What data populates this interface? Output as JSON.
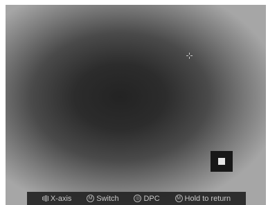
{
  "hints": [
    {
      "icon": "scroll-wheel-icon",
      "label": "X-axis"
    },
    {
      "icon": "m-button-icon",
      "label": "Switch",
      "glyph": "M"
    },
    {
      "icon": "camera-button-icon",
      "label": "DPC",
      "glyph": "◎"
    },
    {
      "icon": "m-button-icon",
      "label": "Hold to return",
      "glyph": "M"
    }
  ],
  "colors": {
    "image_center": "#232323",
    "image_edge": "#a6a6a6",
    "hint_text": "#c9c9c9",
    "hint_bar_bg": "#242424",
    "pip_marker": "#e6e6e6"
  }
}
